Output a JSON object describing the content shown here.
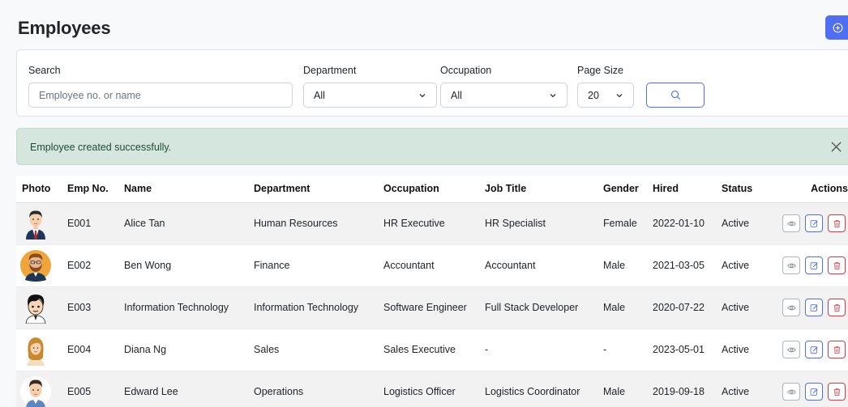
{
  "page": {
    "title": "Employees"
  },
  "filters": {
    "search": {
      "label": "Search",
      "placeholder": "Employee no. or name"
    },
    "department": {
      "label": "Department",
      "value": "All"
    },
    "occupation": {
      "label": "Occupation",
      "value": "All"
    },
    "page_size": {
      "label": "Page Size",
      "value": "20"
    }
  },
  "alert": {
    "message": "Employee created successfully.",
    "color": "#d4e6dd"
  },
  "table": {
    "headers": [
      "Photo",
      "Emp No.",
      "Name",
      "Department",
      "Occupation",
      "Job Title",
      "Gender",
      "Hired",
      "Status",
      "Actions"
    ],
    "rows": [
      {
        "emp_no": "E001",
        "name": "Alice Tan",
        "department": "Human Resources",
        "occupation": "HR Executive",
        "job_title": "HR Specialist",
        "gender": "Female",
        "hired": "2022-01-10",
        "status": "Active",
        "avatar": "man-suit-avatar"
      },
      {
        "emp_no": "E002",
        "name": "Ben Wong",
        "department": "Finance",
        "occupation": "Accountant",
        "job_title": "Accountant",
        "gender": "Male",
        "hired": "2021-03-05",
        "status": "Active",
        "avatar": "bearded-man-avatar"
      },
      {
        "emp_no": "E003",
        "name": "Information Technology",
        "department": "Information Technology",
        "occupation": "Software Engineer",
        "job_title": "Full Stack Developer",
        "gender": "Male",
        "hired": "2020-07-22",
        "status": "Active",
        "avatar": "dark-hair-man-avatar"
      },
      {
        "emp_no": "E004",
        "name": "Diana Ng",
        "department": "Sales",
        "occupation": "Sales Executive",
        "job_title": "-",
        "gender": "-",
        "hired": "2023-05-01",
        "status": "Active",
        "avatar": "woman-avatar"
      },
      {
        "emp_no": "E005",
        "name": "Edward Lee",
        "department": "Operations",
        "occupation": "Logistics Officer",
        "job_title": "Logistics Coordinator",
        "gender": "Male",
        "hired": "2019-09-18",
        "status": "Active",
        "avatar": "man-shirt-avatar"
      }
    ]
  },
  "colors": {
    "primary": "#4f6ef2",
    "danger": "#dc3545",
    "success_bg": "#d4e6dd"
  },
  "icons": {
    "add": "plus-circle-icon",
    "search": "search-icon",
    "view": "eye-icon",
    "edit": "edit-icon",
    "delete": "trash-icon",
    "close": "close-icon"
  }
}
